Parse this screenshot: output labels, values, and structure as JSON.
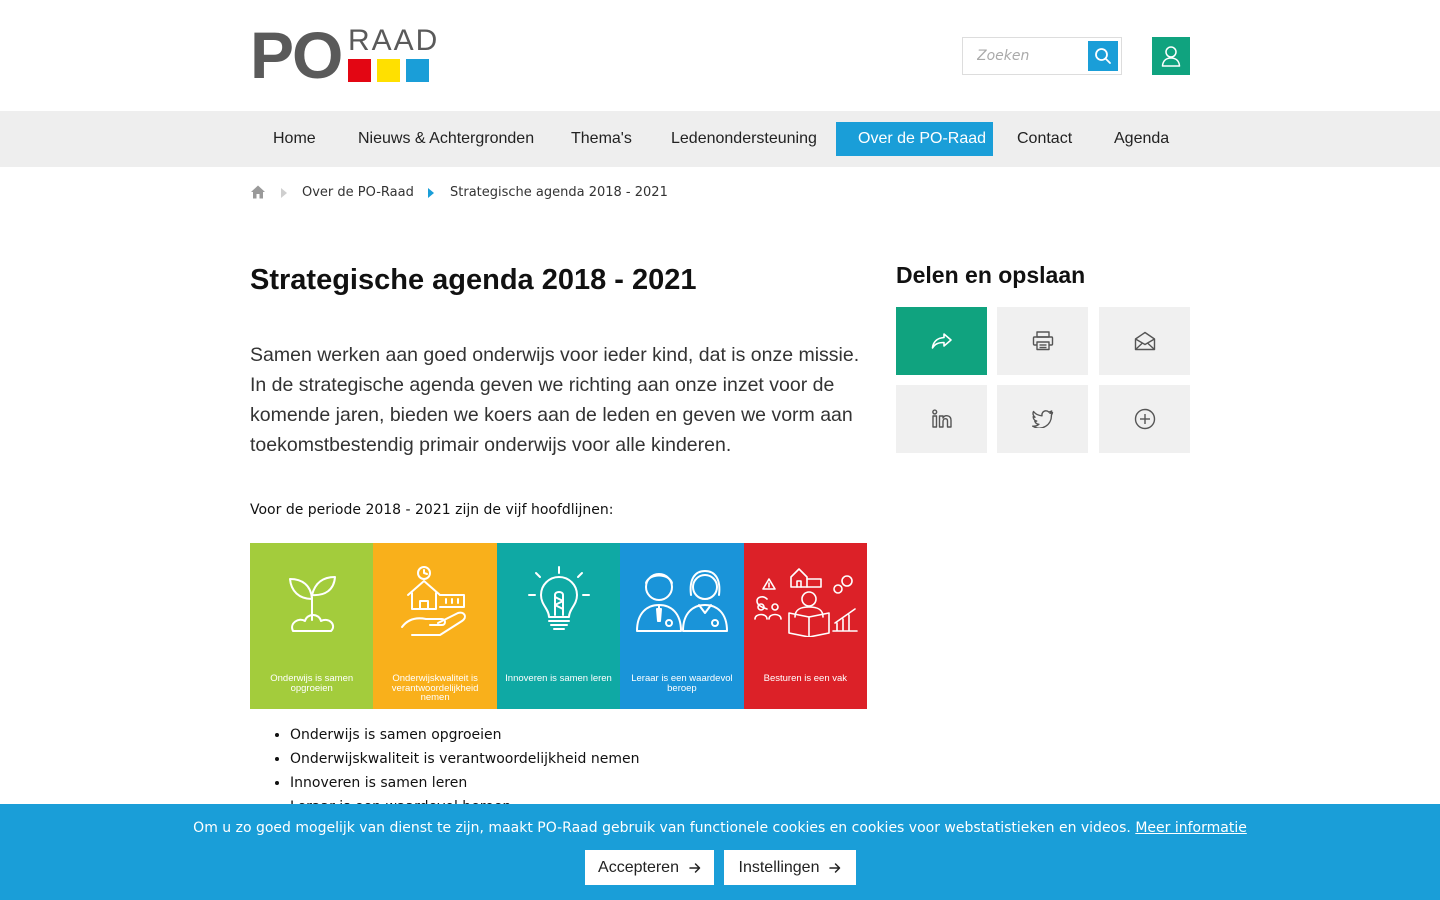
{
  "logo": {
    "text_po": "PO",
    "text_raad": "RAAD",
    "colors": [
      "#e30613",
      "#ffe000",
      "#1a9ed8"
    ]
  },
  "search": {
    "placeholder": "Zoeken",
    "icon": "search-icon"
  },
  "account": {
    "icon": "user-icon"
  },
  "nav": {
    "items": [
      {
        "label": "Home",
        "active": false
      },
      {
        "label": "Nieuws & Achtergronden",
        "active": false
      },
      {
        "label": "Thema's",
        "active": false
      },
      {
        "label": "Ledenondersteuning",
        "active": false
      },
      {
        "label": "Over de PO-Raad",
        "active": true
      },
      {
        "label": "Contact",
        "active": false
      },
      {
        "label": "Agenda",
        "active": false
      }
    ]
  },
  "breadcrumb": {
    "home_icon": "home-icon",
    "parent": "Over de PO-Raad",
    "current": "Strategische agenda 2018 - 2021"
  },
  "main": {
    "title": "Strategische agenda 2018 - 2021",
    "intro": "Samen werken aan goed onderwijs voor ieder kind, dat is onze missie. In de strategische agenda geven we richting aan onze inzet voor de komende jaren, bieden we koers aan de leden en geven we vorm aan toekomstbestendig primair onderwijs voor alle kinderen.",
    "lead": "Voor de periode 2018 - 2021 zijn de vijf hoofdlijnen:",
    "banner": [
      {
        "caption": "Onderwijs is samen opgroeien",
        "color": "#a3cc3c",
        "icon": "plant-icon"
      },
      {
        "caption": "Onderwijskwaliteit is verantwoordelijkheid nemen",
        "color": "#f9b01b",
        "icon": "hand-school-icon"
      },
      {
        "caption": "Innoveren is samen leren",
        "color": "#0fa9a4",
        "icon": "lightbulb-icon"
      },
      {
        "caption": "Leraar is een waardevol beroep",
        "color": "#1a94d9",
        "icon": "teachers-icon"
      },
      {
        "caption": "Besturen is een vak",
        "color": "#dc2128",
        "icon": "governance-icon"
      }
    ],
    "list": [
      "Onderwijs is samen opgroeien",
      "Onderwijskwaliteit is verantwoordelijkheid nemen",
      "Innoveren is samen leren",
      "Leraar is een waardevol beroep"
    ]
  },
  "sidebar": {
    "title": "Delen en opslaan",
    "buttons": [
      "share-icon",
      "print-icon",
      "mail-icon",
      "linkedin-icon",
      "twitter-icon",
      "plus-circle-icon"
    ]
  },
  "cookie": {
    "text": "Om u zo goed mogelijk van dienst te zijn, maakt PO-Raad gebruik van functionele cookies en cookies voor webstatistieken en videos.",
    "link": "Meer informatie",
    "accept": "Accepteren",
    "settings": "Instellingen",
    "colors": {
      "bar": "#1a9ed8"
    }
  }
}
